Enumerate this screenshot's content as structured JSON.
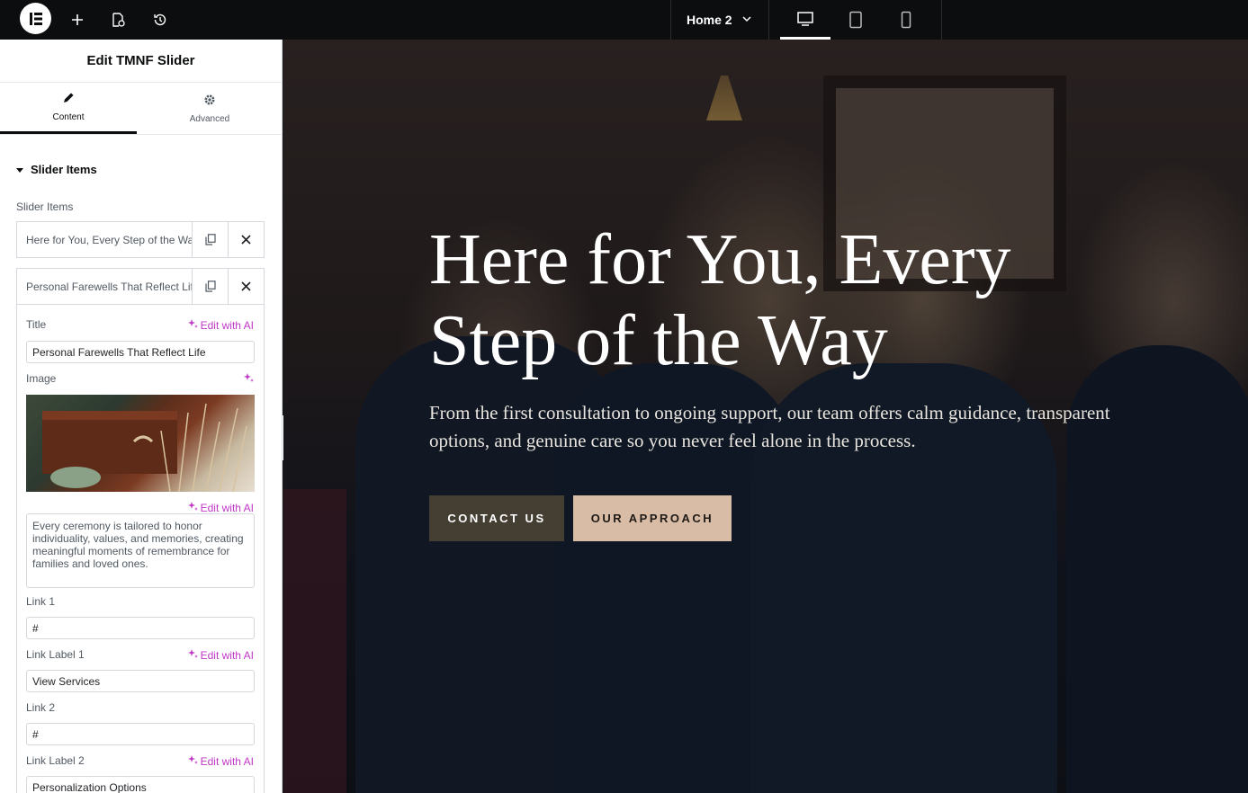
{
  "topbar": {
    "page_name": "Home 2",
    "icons": [
      "elementor-logo-icon",
      "plus-icon",
      "page-settings-icon",
      "history-icon",
      "chevron-down-icon",
      "desktop-icon",
      "tablet-icon",
      "mobile-icon"
    ]
  },
  "panel": {
    "title": "Edit TMNF Slider",
    "tabs": [
      {
        "label": "Content",
        "icon": "pencil-icon",
        "active": true
      },
      {
        "label": "Advanced",
        "icon": "gear-icon",
        "active": false
      }
    ],
    "section_title": "Slider Items",
    "repeater_label": "Slider Items",
    "items": [
      {
        "title": "Here for You, Every Step of the Way"
      },
      {
        "title": "Personal Farewells That Reflect Life"
      }
    ],
    "fields": {
      "title_label": "Title",
      "title_value": "Personal Farewells That Reflect Life",
      "image_label": "Image",
      "ai_label": "Edit with AI",
      "description_value": "Every ceremony is tailored to honor individuality, values, and memories, creating meaningful moments of remembrance for families and loved ones.",
      "link1_label": "Link 1",
      "link1_value": "#",
      "link_label1_label": "Link Label 1",
      "link_label1_value": "View Services",
      "link2_label": "Link 2",
      "link2_value": "#",
      "link_label2_label": "Link Label 2",
      "link_label2_value": "Personalization Options"
    }
  },
  "preview": {
    "hero_title_line1": "Here for You, Every",
    "hero_title_line2": "Step of the Way",
    "hero_subtitle": "From the first consultation to ongoing support, our team offers calm guidance, transparent options, and genuine care so you never feel alone in the process.",
    "button_primary": "CONTACT US",
    "button_secondary": "OUR APPROACH"
  },
  "colors": {
    "topbar_bg": "#0c0d0e",
    "ai_accent": "#c036c7",
    "button_primary_bg": "#453f33",
    "button_secondary_bg": "#d8bca5"
  }
}
